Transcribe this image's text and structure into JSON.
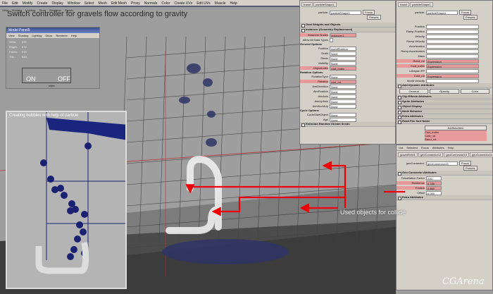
{
  "menubar": [
    "File",
    "Edit",
    "Modify",
    "Create",
    "Display",
    "Window",
    "Select",
    "Mesh",
    "Edit Mesh",
    "Proxy",
    "Normals",
    "Color",
    "Create UVs",
    "Edit UVs",
    "Muscle",
    "Help"
  ],
  "viewport_menu": [
    "View",
    "Shading",
    "Lighting",
    "Show",
    "Renderer",
    "Panels"
  ],
  "annotations": {
    "switch_note": "Switch controller for gravels flow according to gravity",
    "collide_note": "Used objects for collide",
    "inset_title": "Creating bubbles with help of particle"
  },
  "model_panel": {
    "title": "Model Panel5",
    "menu": [
      "View",
      "Shading",
      "Lighting",
      "Show",
      "Renderer",
      "Help"
    ],
    "stats": [
      {
        "label": "Verts:",
        "value": "337"
      },
      {
        "label": "Edges:",
        "value": "672"
      },
      {
        "label": "Faces:",
        "value": "370"
      },
      {
        "label": "Tris:",
        "value": "648"
      }
    ],
    "on": "ON",
    "off": "OFF",
    "slider_label": "state"
  },
  "attr_left": {
    "tabs": [
      "transf",
      "particleShape1"
    ],
    "name_label": "particle:",
    "name_value": "particleShape1",
    "focus": "Focus",
    "presets": "Presets",
    "sections": [
      "Goal Weights and Objects",
      "Instancer (Geometry Replacement)"
    ],
    "instancer": {
      "label": "Instancer Nodes",
      "value": "instancer1",
      "allow": "Allow All Data Types"
    },
    "general_title": "General Options",
    "general": [
      {
        "label": "Position",
        "value": "worldPosition"
      },
      {
        "label": "Scale",
        "value": "None"
      },
      {
        "label": "Shear",
        "value": "None"
      },
      {
        "label": "Visibility",
        "value": "None"
      },
      {
        "label": "ObjectIndex",
        "value": "cust_index",
        "pink": true
      }
    ],
    "rotation_title": "Rotation Options",
    "rotation": [
      {
        "label": "RotationType",
        "value": "None"
      },
      {
        "label": "Rotation",
        "value": "cust_rot",
        "pink": true
      },
      {
        "label": "AimDirection",
        "value": "None"
      },
      {
        "label": "AimPosition",
        "value": "None"
      },
      {
        "label": "AimAxis",
        "value": "None"
      },
      {
        "label": "AimUpAxis",
        "value": "None"
      },
      {
        "label": "AimWorldUp",
        "value": "None"
      }
    ],
    "cycle_title": "Cycle Options",
    "cycle": [
      {
        "label": "CycleStartObject",
        "value": "None"
      },
      {
        "label": "Age",
        "value": "None"
      }
    ],
    "last_section": "Emission Random Stream Seeds"
  },
  "attr_right": {
    "tabs": [
      "transf",
      "particleShape1"
    ],
    "name_label": "particle:",
    "name_value": "particleShape1",
    "focus": "Focus",
    "presets": "Presets",
    "attrs": [
      {
        "label": "Position"
      },
      {
        "label": "Ramp Position"
      },
      {
        "label": "Velocity"
      },
      {
        "label": "Ramp Velocity"
      },
      {
        "label": "Acceleration"
      },
      {
        "label": "Ramp Acceleration"
      },
      {
        "label": "Mass"
      },
      {
        "label": "Rand_rot",
        "value": "Expression",
        "pink": true
      },
      {
        "label": "Cust_index",
        "value": "Expression",
        "pink": true
      },
      {
        "label": "Lifespan PP"
      },
      {
        "label": "Cust_rot",
        "value": "Expression",
        "pink": true
      },
      {
        "label": "World Velocity"
      }
    ],
    "dyn_section": "Add Dynamic Attributes",
    "dyn_buttons": [
      "General",
      "Opacity",
      "Color"
    ],
    "sections": [
      "Clip Effects Attributes",
      "Sprite Attributes",
      "Object Display",
      "Node Behavior",
      "Extra Attributes",
      "Read Pdc Sort Name"
    ],
    "pdc_button": "AddNewItem",
    "pdc_items": [
      "Cust_index",
      "Cust_rot",
      "Rand_rot"
    ]
  },
  "attr_bottom": {
    "menu": [
      "List",
      "Selected",
      "Focus",
      "Attributes",
      "Help"
    ],
    "tabs": [
      "gravelField1",
      "geoConnector12",
      "geoConnector13",
      "geoConnector14",
      "geoConne"
    ],
    "name_label": "geoConnector:",
    "name_value": "geoConnector13",
    "focus": "Focus",
    "presets": "Presets",
    "section": "Geo Connector Attributes",
    "fields": [
      {
        "label": "Tessellation Factor",
        "value": "200"
      },
      {
        "label": "Resilience",
        "value": "0.780",
        "pink": true
      },
      {
        "label": "Friction",
        "value": "0.860",
        "pink": true
      },
      {
        "label": "Offset",
        "value": "0.000"
      }
    ],
    "extra": "Extra Attributes"
  },
  "watermark": "CGArena"
}
